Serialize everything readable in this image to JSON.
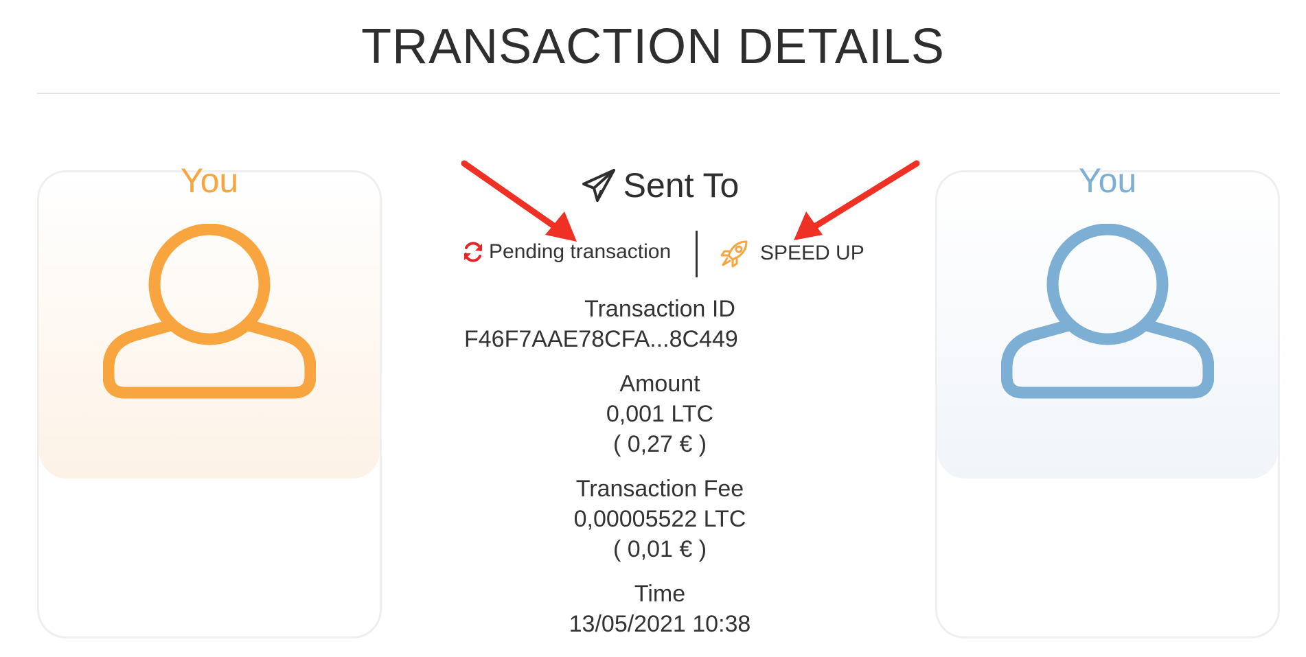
{
  "page": {
    "title": "TRANSACTION DETAILS"
  },
  "sender": {
    "name": "You",
    "color": "#f8a540"
  },
  "recipient": {
    "name": "You",
    "color": "#7daed4"
  },
  "direction": {
    "label": "Sent To",
    "icon": "paper-plane-icon"
  },
  "status": {
    "pending_label": "Pending transaction",
    "pending_icon": "refresh-icon",
    "pending_icon_color": "#e8262a",
    "speed_up_label": "SPEED UP",
    "speed_up_icon": "rocket-icon",
    "speed_up_icon_color": "#f8a540"
  },
  "details": {
    "transaction_id_label": "Transaction ID",
    "transaction_id": "F46F7AAE78CFA...8C449",
    "amount_label": "Amount",
    "amount": "0,001 LTC",
    "amount_fiat": "( 0,27 € )",
    "fee_label": "Transaction Fee",
    "fee": "0,00005522 LTC",
    "fee_fiat": "( 0,01 € )",
    "time_label": "Time",
    "time": "13/05/2021 10:38"
  },
  "annotations": {
    "arrow_color": "#ee3124"
  }
}
